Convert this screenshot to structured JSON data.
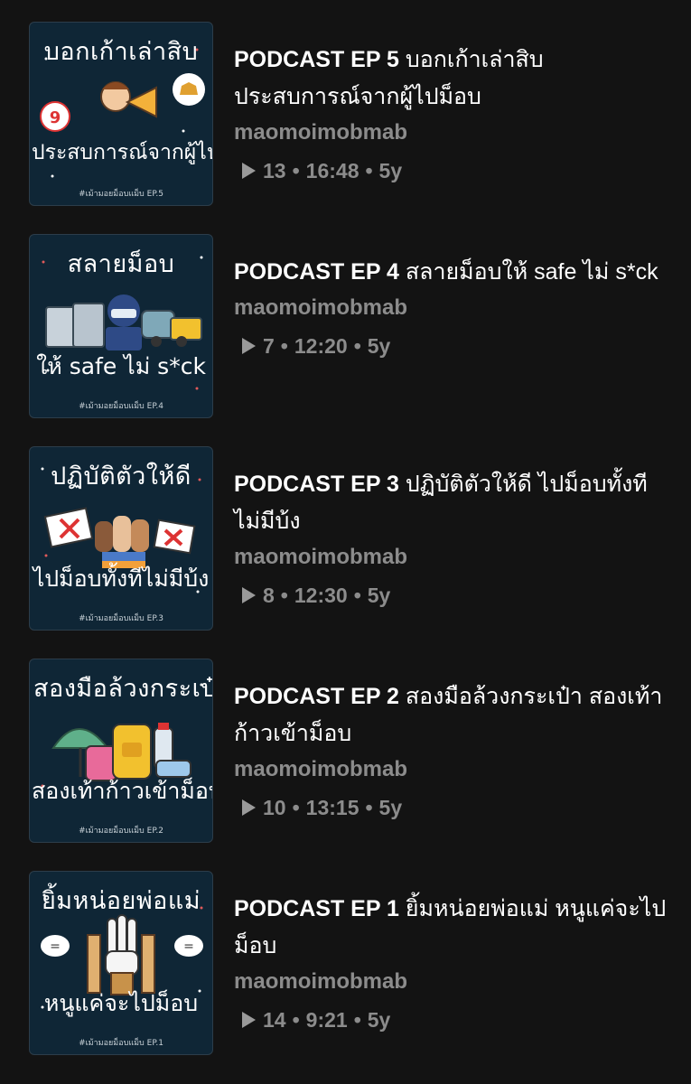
{
  "episodes": [
    {
      "title_prefix": "PODCAST EP 5",
      "title_rest": " บอกเก้าเล่าสิบประสบการณ์จากผู้ไปม็อบ",
      "author": "maomoimobmab",
      "plays": "13",
      "duration": "16:48",
      "age": "5y",
      "thumb": {
        "top": "บอกเก้าเล่าสิบ",
        "bottom": "ประสบการณ์จากผู้ไปม็อบ",
        "tag": "#เม้ามอยม็อบแม็บ EP.5",
        "icon": "megaphone-person-icon"
      }
    },
    {
      "title_prefix": "PODCAST EP 4",
      "title_rest": " สลายม็อบให้ safe ไม่ s*ck",
      "author": "maomoimobmab",
      "plays": "7",
      "duration": "12:20",
      "age": "5y",
      "thumb": {
        "top": "สลายม็อบ",
        "bottom": "ให้ safe ไม่ s*ck",
        "tag": "#เม้ามอยม็อบแม็บ EP.4",
        "icon": "riot-police-icon"
      }
    },
    {
      "title_prefix": "PODCAST EP 3",
      "title_rest": " ปฏิบัติตัวให้ดี ไปม็อบทั้งทีไม่มีบ้ง",
      "author": "maomoimobmab",
      "plays": "8",
      "duration": "12:30",
      "age": "5y",
      "thumb": {
        "top": "ปฏิบัติตัวให้ดี",
        "bottom": "ไปม็อบทั้งทีไม่มีบ้ง",
        "tag": "#เม้ามอยม็อบแม็บ EP.3",
        "icon": "raised-fists-icon"
      }
    },
    {
      "title_prefix": "PODCAST EP 2",
      "title_rest": " สองมือล้วงกระเป๋า สองเท้าก้าวเข้าม็อบ",
      "author": "maomoimobmab",
      "plays": "10",
      "duration": "13:15",
      "age": "5y",
      "thumb": {
        "top": "สองมือล้วงกระเป๋า",
        "bottom": "สองเท้าก้าวเข้าม็อบ",
        "tag": "#เม้ามอยม็อบแม็บ EP.2",
        "icon": "backpack-supplies-icon"
      }
    },
    {
      "title_prefix": "PODCAST EP 1",
      "title_rest": " ยิ้มหน่อยพ่อแม่ หนูแค่จะไปม็อบ",
      "author": "maomoimobmab",
      "plays": "14",
      "duration": "9:21",
      "age": "5y",
      "thumb": {
        "top": "ยิ้มหน่อยพ่อแม่",
        "bottom": "หนูแค่จะไปม็อบ",
        "tag": "#เม้ามอยม็อบแม็บ EP.1",
        "icon": "three-finger-salute-icon"
      }
    }
  ],
  "separator": "•",
  "colors": {
    "background": "#131313",
    "thumb_background": "#0f2636",
    "muted_text": "#8c8c8c"
  }
}
